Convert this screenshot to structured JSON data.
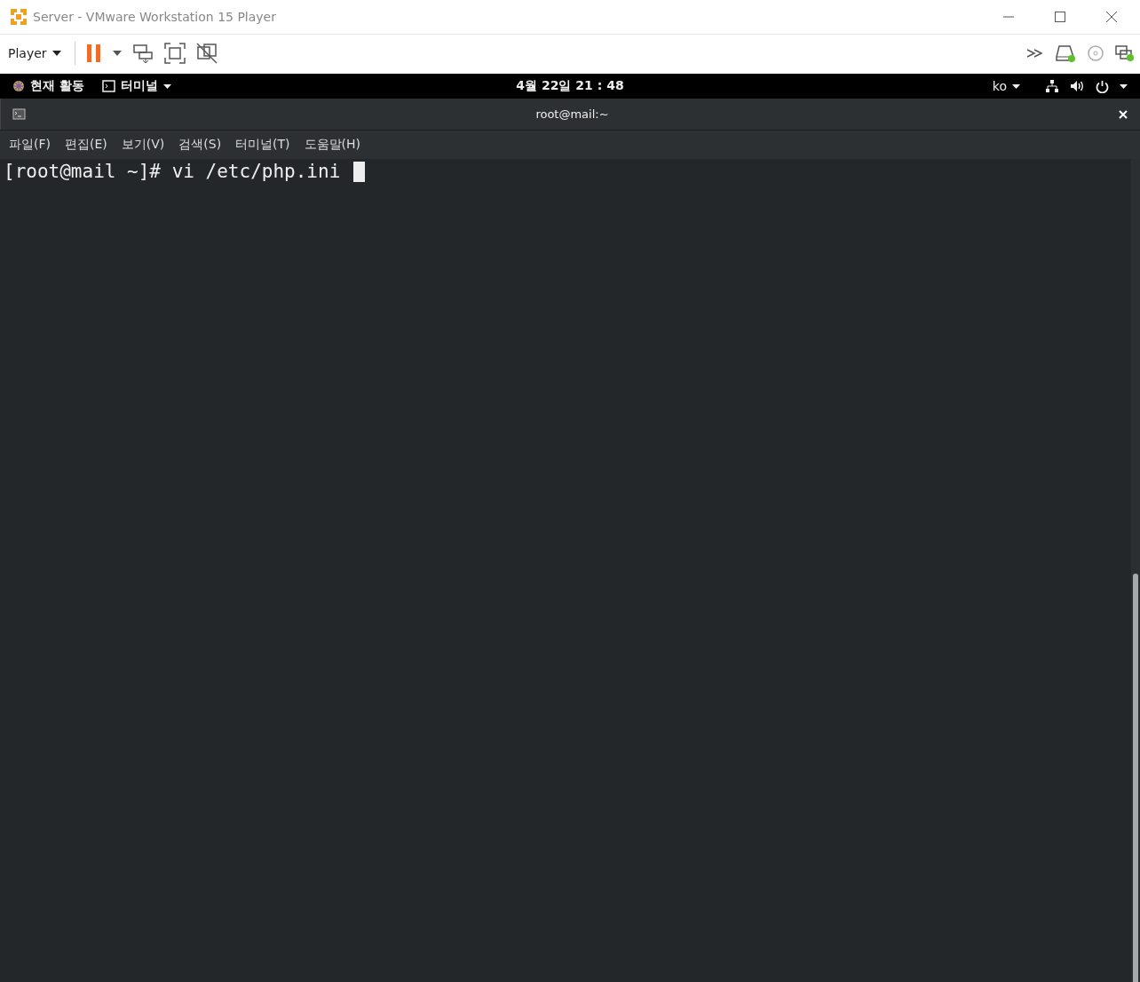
{
  "window": {
    "title": "Server - VMware Workstation 15 Player"
  },
  "toolbar": {
    "player_menu": "Player"
  },
  "top_bar": {
    "activities": "현재 활동",
    "app_menu": "터미널",
    "clock": "4월 22일  21 : 48",
    "input_method": "ko"
  },
  "terminal": {
    "title": "root@mail:~",
    "menu": [
      "파일(F)",
      "편집(E)",
      "보기(V)",
      "검색(S)",
      "터미널(T)",
      "도움말(H)"
    ],
    "lines": [
      "[root@mail ~]# vi /etc/php.ini "
    ]
  }
}
